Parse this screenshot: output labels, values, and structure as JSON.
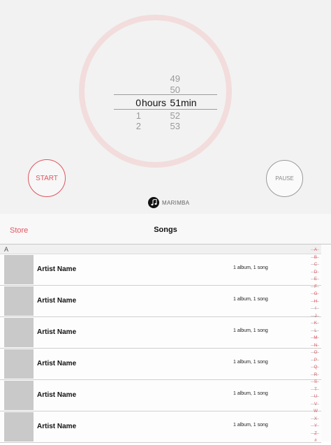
{
  "timer": {
    "picker": {
      "hours_above": [],
      "minutes_above": [
        "49",
        "50"
      ],
      "selected_hours": "0",
      "hours_unit": "hours",
      "selected_minutes": "51",
      "minutes_unit": "min",
      "hours_below": [
        "1",
        "2"
      ],
      "minutes_below": [
        "52",
        "53"
      ]
    },
    "start_label": "START",
    "pause_label": "PAUSE",
    "sound": {
      "icon": "music-note-icon",
      "label": "MARIMBA"
    }
  },
  "music": {
    "nav": {
      "back_label": "Store",
      "title": "Songs"
    },
    "section_header": "A",
    "rows": [
      {
        "artist": "Artist Name",
        "meta": "1 album, 1 song"
      },
      {
        "artist": "Artist Name",
        "meta": "1 album, 1 song"
      },
      {
        "artist": "Artist Name",
        "meta": "1 album, 1 song"
      },
      {
        "artist": "Artist Name",
        "meta": "1 album, 1 song"
      },
      {
        "artist": "Artist Name",
        "meta": "1 album, 1 song"
      },
      {
        "artist": "Artist Name",
        "meta": "1 album, 1 song"
      }
    ],
    "index_letters": [
      "A",
      "B",
      "C",
      "D",
      "E",
      "F",
      "G",
      "H",
      "I",
      "J",
      "K",
      "L",
      "M",
      "N",
      "O",
      "P",
      "Q",
      "R",
      "S",
      "T",
      "U",
      "V",
      "W",
      "X",
      "Y",
      "Z",
      "#"
    ]
  },
  "colors": {
    "accent": "#e05561",
    "ring": "#f3dcdc",
    "timer_bg": "#f2f2f2"
  }
}
